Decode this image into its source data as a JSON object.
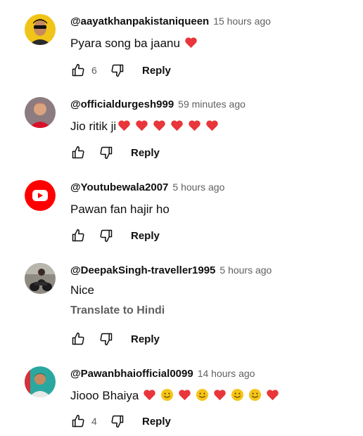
{
  "comments": [
    {
      "author": "@aayatkhanpakistaniqueen",
      "time": "15 hours ago",
      "text": "Pyara song ba jaanu",
      "emojis": [
        "heart"
      ],
      "likes": "6",
      "reply_label": "Reply"
    },
    {
      "author": "@officialdurgesh999",
      "time": "59 minutes ago",
      "text": "Jio ritik ji",
      "emojis": [
        "heart",
        "heart",
        "heart",
        "heart",
        "heart",
        "heart"
      ],
      "likes": "",
      "reply_label": "Reply"
    },
    {
      "author": "@Youtubewala2007",
      "time": "5 hours ago",
      "text": "Pawan fan hajir ho",
      "emojis": [],
      "likes": "",
      "reply_label": "Reply"
    },
    {
      "author": "@DeepakSingh-traveller1995",
      "time": "5 hours ago",
      "text": "Nice",
      "translate": "Translate to Hindi",
      "emojis": [],
      "likes": "",
      "reply_label": "Reply"
    },
    {
      "author": "@Pawanbhaiofficial0099",
      "time": "14 hours ago",
      "text": "Jiooo Bhaiya",
      "emojis": [
        "heart",
        "smile",
        "heart",
        "smile",
        "heart",
        "smile",
        "smile",
        "heart"
      ],
      "likes": "4",
      "reply_label": "Reply"
    }
  ],
  "colors": {
    "heart": "#e8363a",
    "smile": "#f5c518",
    "youtube_red": "#ff0000",
    "secondary_text": "#606060"
  },
  "icons": [
    "thumbs-up-icon",
    "thumbs-down-icon",
    "heart-emoji",
    "smile-emoji"
  ]
}
